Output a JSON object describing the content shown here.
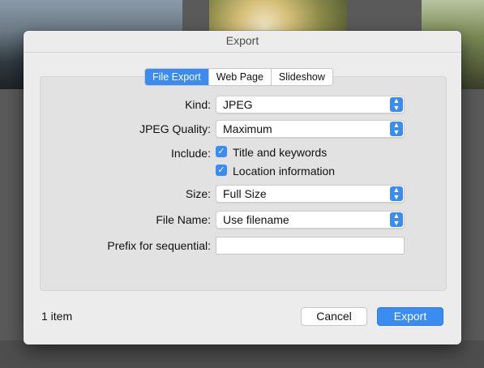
{
  "dialog": {
    "title": "Export"
  },
  "tabs": [
    {
      "label": "File Export",
      "active": true
    },
    {
      "label": "Web Page",
      "active": false
    },
    {
      "label": "Slideshow",
      "active": false
    }
  ],
  "form": {
    "kind": {
      "label": "Kind:",
      "value": "JPEG"
    },
    "jpeg_quality": {
      "label": "JPEG Quality:",
      "value": "Maximum"
    },
    "include": {
      "label": "Include:",
      "options": [
        {
          "label": "Title and keywords",
          "checked": true
        },
        {
          "label": "Location information",
          "checked": true
        }
      ]
    },
    "size": {
      "label": "Size:",
      "value": "Full Size"
    },
    "file_name": {
      "label": "File Name:",
      "value": "Use filename"
    },
    "prefix": {
      "label": "Prefix for sequential:",
      "value": ""
    }
  },
  "footer": {
    "count": "1 item",
    "cancel_label": "Cancel",
    "export_label": "Export"
  },
  "icons": {
    "checkmark": "✓",
    "stepper_up": "▲",
    "stepper_down": "▼"
  },
  "colors": {
    "accent": "#3a8cf2"
  }
}
